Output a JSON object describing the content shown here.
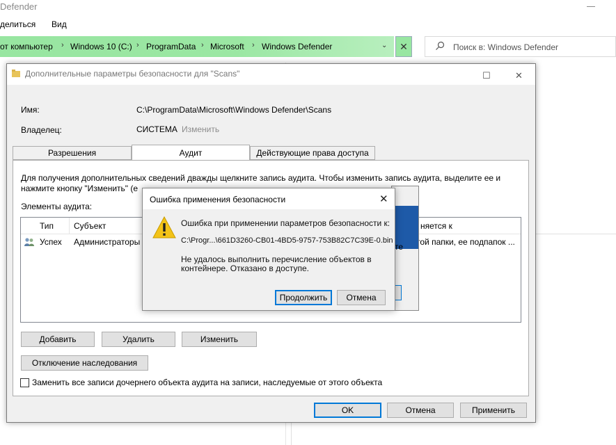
{
  "explorer": {
    "title": "Defender",
    "ribbon": {
      "tab1": "делиться",
      "tab2": "Вид"
    },
    "breadcrumb": [
      "от компьютер",
      "Windows 10 (C:)",
      "ProgramData",
      "Microsoft",
      "Windows Defender"
    ],
    "search_placeholder": "Поиск в: Windows Defender",
    "accent_color": "#98e6a1"
  },
  "advanced_dialog": {
    "title": "Дополнительные параметры безопасности  для \"Scans\"",
    "name_label": "Имя:",
    "name_value": "C:\\ProgramData\\Microsoft\\Windows Defender\\Scans",
    "owner_label": "Владелец:",
    "owner_value": "СИСТЕМА",
    "owner_change_link": "Изменить",
    "tabs": [
      "Разрешения",
      "Аудит",
      "Действующие права доступа"
    ],
    "active_tab": "Аудит",
    "info_line1": "Для получения дополнительных сведений дважды щелкните запись аудита. Чтобы изменить запись аудита, выделите ее и",
    "info_line2_start": "нажмите кнопку \"Изменить\" (е",
    "audit_elements_label": "Элементы аудита:",
    "columns": {
      "type": "Тип",
      "subject": "Субъект",
      "applies_to_tail": "няется к"
    },
    "rows": [
      {
        "type": "Успех",
        "subject": "Администраторы",
        "applies_to_tail": "той папки, ее подпапок ..."
      }
    ],
    "add_button": "Добавить",
    "remove_button": "Удалить",
    "edit_button": "Изменить",
    "disable_inheritance_button": "Отключение наследования",
    "replace_checkbox_label": "Заменить все записи дочернего объекта аудита на записи, наследуемые от этого объекта",
    "ok_button": "OK",
    "cancel_button": "Отмена",
    "apply_button": "Применить"
  },
  "middle_dialog": {
    "partial_text": "те"
  },
  "error_dialog": {
    "title": "Ошибка применения безопасности",
    "message_line1": "Ошибка при применении параметров безопасности к:",
    "path": "C:\\Progr...\\661D3260-CB01-4BD5-9757-753B82C7C39E-0.bin",
    "message_line2": "Не удалось выполнить перечисление объектов в",
    "message_line3": "контейнере. Отказано в доступе.",
    "continue_button": "Продолжить",
    "cancel_button": "Отмена"
  }
}
